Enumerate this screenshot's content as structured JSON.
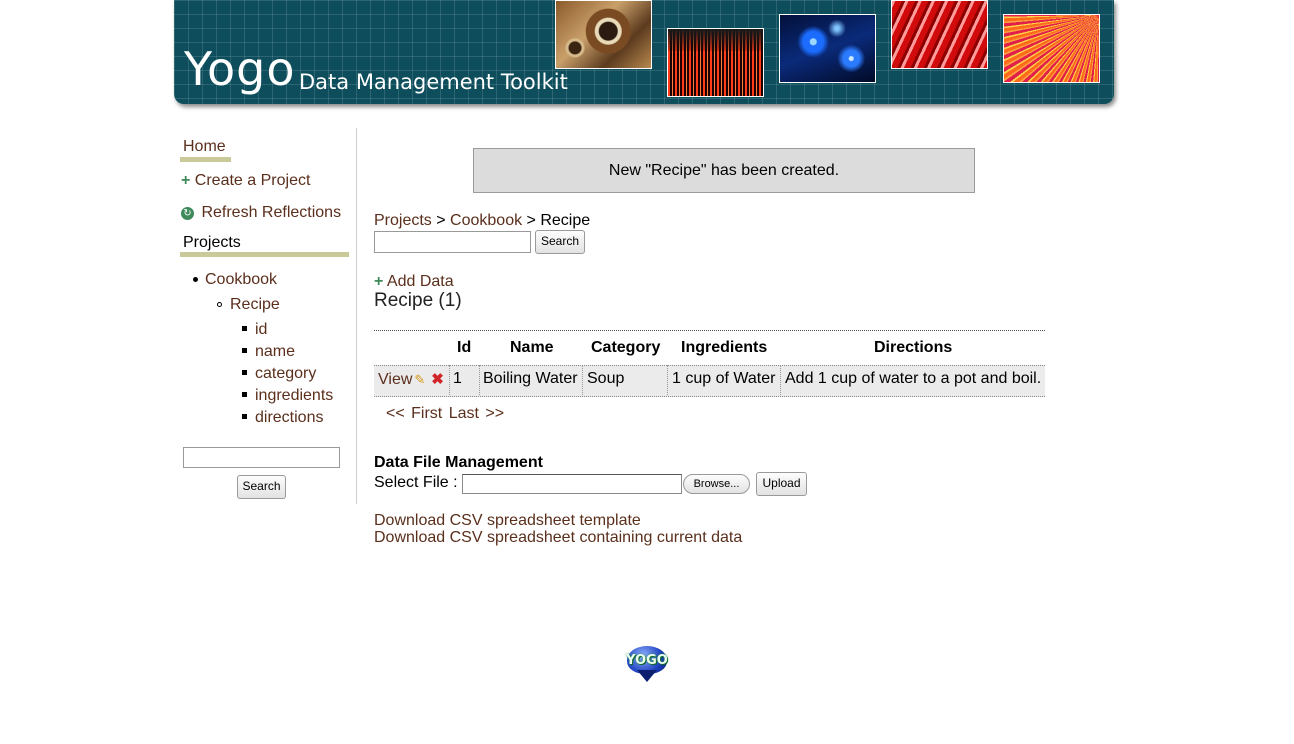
{
  "header": {
    "logo_word": "Yogo",
    "logo_subtitle": "Data Management Toolkit"
  },
  "sidebar": {
    "home_label": "Home",
    "create_project_label": "Create a Project",
    "refresh_label": "Refresh Reflections",
    "projects_heading": "Projects",
    "tree": {
      "project": "Cookbook",
      "model": "Recipe",
      "fields": [
        "id",
        "name",
        "category",
        "ingredients",
        "directions"
      ]
    },
    "search_button": "Search"
  },
  "notice": "New \"Recipe\" has been created.",
  "breadcrumb": {
    "projects": "Projects",
    "sep": ">",
    "cookbook": "Cookbook",
    "current": "Recipe"
  },
  "search_button": "Search",
  "add_data_label": "Add Data",
  "recipe_heading": "Recipe (1)",
  "table": {
    "headers": [
      "Id",
      "Name",
      "Category",
      "Ingredients",
      "Directions"
    ],
    "rows": [
      {
        "action": "View",
        "id": "1",
        "name": "Boiling Water",
        "category": "Soup",
        "ingredients": "1 cup of Water",
        "directions": "Add 1 cup of water to a pot and boil."
      }
    ]
  },
  "pager": {
    "first": "<< First",
    "last": "Last >>"
  },
  "file_management": {
    "title": "Data File Management",
    "select_label": "Select File :",
    "browse_button": "Browse...",
    "upload_button": "Upload"
  },
  "downloads": {
    "template": "Download CSV spreadsheet template",
    "current": "Download CSV spreadsheet containing current data"
  },
  "footer_logo_word": "YOGO",
  "colors": {
    "header_bg": "#0e4d5c",
    "link": "#5a2f1c",
    "accent_bar": "#c9c99a",
    "notice_bg": "#dcdcdc",
    "row_bg": "#ebebeb"
  }
}
